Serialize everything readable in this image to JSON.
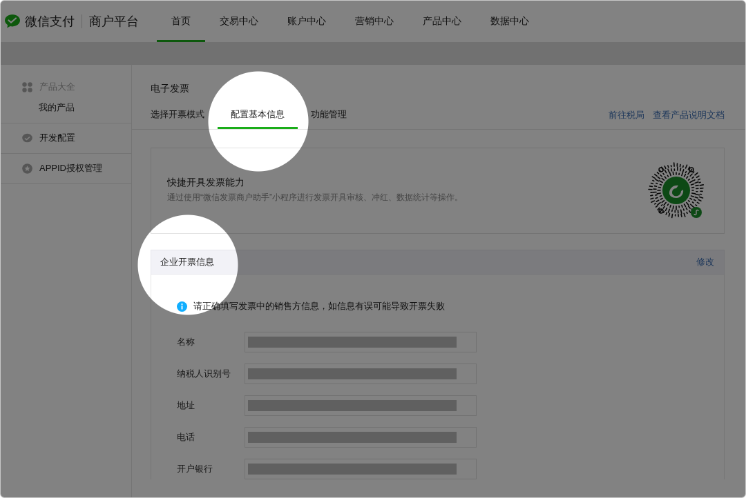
{
  "header": {
    "brand": "微信支付",
    "platform": "商户平台",
    "nav": [
      {
        "label": "首页",
        "selected": true
      },
      {
        "label": "交易中心",
        "selected": false
      },
      {
        "label": "账户中心",
        "selected": false
      },
      {
        "label": "营销中心",
        "selected": false
      },
      {
        "label": "产品中心",
        "selected": false
      },
      {
        "label": "数据中心",
        "selected": false
      }
    ]
  },
  "sidebar": {
    "items": [
      {
        "label": "产品大全",
        "kind": "category",
        "children": [
          {
            "label": "我的产品"
          }
        ]
      },
      {
        "label": "开发配置",
        "kind": "item"
      },
      {
        "label": "APPID授权管理",
        "kind": "item"
      }
    ]
  },
  "main": {
    "title": "电子发票",
    "tabs": [
      {
        "label": "选择开票模式",
        "selected": false
      },
      {
        "label": "配置基本信息",
        "selected": true
      },
      {
        "label": "功能管理",
        "selected": false
      }
    ],
    "links": [
      "前往税局",
      "查看产品说明文档"
    ],
    "promo": {
      "title": "快捷开具发票能力",
      "description": "通过使用“微信发票商户助手”小程序进行发票开具审核、冲红、数据统计等操作。"
    },
    "section": {
      "title": "企业开票信息",
      "action": "修改",
      "notice": "请正确填写发票中的销售方信息，如信息有误可能导致开票失败",
      "fields": [
        {
          "label": "名称"
        },
        {
          "label": "纳税人识别号"
        },
        {
          "label": "地址"
        },
        {
          "label": "电话"
        },
        {
          "label": "开户银行"
        }
      ]
    }
  }
}
